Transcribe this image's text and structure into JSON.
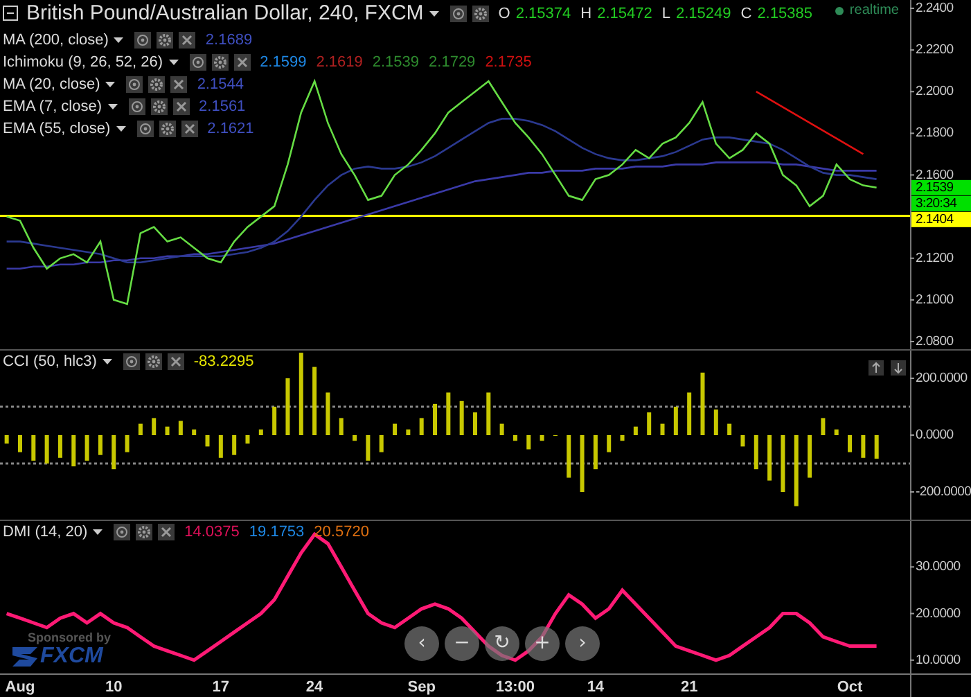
{
  "panels": [
    {
      "kind": "price",
      "legend": {
        "title": "British Pound/Australian Dollar, 240, FXCM",
        "ohlc": [
          {
            "label": "O",
            "value": "2.15374"
          },
          {
            "label": "H",
            "value": "2.15472"
          },
          {
            "label": "L",
            "value": "2.15249"
          },
          {
            "label": "C",
            "value": "2.15385"
          }
        ],
        "status": "realtime",
        "indicators": [
          {
            "name": "MA (200, close)",
            "values": [
              {
                "text": "2.1689",
                "color": "#3f4fc0"
              }
            ]
          },
          {
            "name": "Ichimoku (9, 26, 52, 26)",
            "values": [
              {
                "text": "2.1599",
                "color": "#1e88e5"
              },
              {
                "text": "2.1619",
                "color": "#b02020"
              },
              {
                "text": "2.1539",
                "color": "#2e8b2e"
              },
              {
                "text": "2.1729",
                "color": "#2e8b2e"
              },
              {
                "text": "2.1735",
                "color": "#d01010"
              }
            ]
          },
          {
            "name": "MA (20, close)",
            "values": [
              {
                "text": "2.1544",
                "color": "#3f4fc0"
              }
            ]
          },
          {
            "name": "EMA (7, close)",
            "values": [
              {
                "text": "2.1561",
                "color": "#3f4fc0"
              }
            ]
          },
          {
            "name": "EMA (55, close)",
            "values": [
              {
                "text": "2.1621",
                "color": "#3f4fc0"
              }
            ]
          }
        ]
      },
      "chart_data": {
        "type": "line",
        "ylim": [
          2.076,
          2.244
        ],
        "yticks": [
          {
            "value": 2.24,
            "label": "2.2400"
          },
          {
            "value": 2.22,
            "label": "2.2200"
          },
          {
            "value": 2.2,
            "label": "2.2000"
          },
          {
            "value": 2.18,
            "label": "2.1800"
          },
          {
            "value": 2.16,
            "label": "2.1600"
          },
          {
            "value": 2.12,
            "label": "2.1200"
          },
          {
            "value": 2.1,
            "label": "2.1000"
          },
          {
            "value": 2.08,
            "label": "2.0800"
          }
        ],
        "series": [
          {
            "color": "#e01010",
            "values": [
              null,
              null,
              null,
              null,
              null,
              null,
              null,
              null,
              null,
              null,
              null,
              null,
              null,
              null,
              null,
              null,
              null,
              null,
              null,
              null,
              null,
              null,
              null,
              null,
              null,
              null,
              null,
              null,
              null,
              null,
              null,
              null,
              null,
              null,
              null,
              null,
              null,
              null,
              null,
              null,
              null,
              null,
              null,
              null,
              null,
              null,
              null,
              null,
              null,
              null,
              null,
              null,
              null,
              null,
              null,
              null,
              2.2,
              null,
              null,
              null,
              null,
              null,
              null,
              null,
              2.17,
              null,
              null,
              null
            ]
          },
          {
            "color": "#3a3aa8",
            "values": [
              2.115,
              2.115,
              2.116,
              2.116,
              2.117,
              2.117,
              2.118,
              2.118,
              2.119,
              2.119,
              2.12,
              2.12,
              2.121,
              2.121,
              2.122,
              2.122,
              2.123,
              2.124,
              2.125,
              2.126,
              2.127,
              2.129,
              2.131,
              2.133,
              2.135,
              2.137,
              2.139,
              2.141,
              2.143,
              2.145,
              2.147,
              2.149,
              2.151,
              2.153,
              2.155,
              2.157,
              2.158,
              2.159,
              2.16,
              2.161,
              2.161,
              2.162,
              2.162,
              2.162,
              2.163,
              2.163,
              2.163,
              2.164,
              2.164,
              2.164,
              2.165,
              2.165,
              2.165,
              2.166,
              2.166,
              2.166,
              2.166,
              2.166,
              2.165,
              2.165,
              2.164,
              2.163,
              2.162,
              2.162,
              2.162,
              2.162,
              null,
              null
            ]
          },
          {
            "color": "#2b3990",
            "values": [
              2.128,
              2.128,
              2.127,
              2.126,
              2.125,
              2.124,
              2.123,
              2.122,
              2.12,
              2.118,
              2.118,
              2.119,
              2.12,
              2.121,
              2.121,
              2.121,
              2.121,
              2.122,
              2.123,
              2.125,
              2.128,
              2.133,
              2.14,
              2.148,
              2.155,
              2.16,
              2.163,
              2.164,
              2.163,
              2.163,
              2.164,
              2.166,
              2.169,
              2.173,
              2.177,
              2.181,
              2.185,
              2.187,
              2.187,
              2.186,
              2.184,
              2.181,
              2.177,
              2.173,
              2.17,
              2.168,
              2.167,
              2.167,
              2.168,
              2.169,
              2.171,
              2.174,
              2.177,
              2.178,
              2.178,
              2.177,
              2.176,
              2.175,
              2.172,
              2.168,
              2.164,
              2.161,
              2.16,
              2.16,
              2.159,
              2.158,
              null,
              null
            ]
          },
          {
            "color": "#66dd44",
            "values": [
              2.14,
              2.138,
              2.125,
              2.115,
              2.12,
              2.122,
              2.118,
              2.128,
              2.1,
              2.098,
              2.132,
              2.135,
              2.128,
              2.13,
              2.125,
              2.12,
              2.118,
              2.128,
              2.135,
              2.14,
              2.145,
              2.165,
              2.19,
              2.205,
              2.185,
              2.17,
              2.16,
              2.148,
              2.15,
              2.16,
              2.165,
              2.172,
              2.18,
              2.19,
              2.195,
              2.2,
              2.205,
              2.195,
              2.185,
              2.178,
              2.17,
              2.16,
              2.15,
              2.148,
              2.158,
              2.16,
              2.165,
              2.172,
              2.168,
              2.175,
              2.178,
              2.185,
              2.195,
              2.175,
              2.168,
              2.172,
              2.18,
              2.175,
              2.16,
              2.155,
              2.145,
              2.15,
              2.165,
              2.158,
              2.155,
              2.1539,
              null,
              null
            ]
          }
        ],
        "ref_lines": [
          {
            "axis": "y",
            "value": 2.1404
          }
        ],
        "annotations": [
          "2.1539",
          "3:20:34",
          "2.1404"
        ]
      }
    },
    {
      "kind": "cci",
      "legend": {
        "indicators": [
          {
            "name": "CCI (50, hlc3)",
            "values": [
              {
                "text": "-83.2295",
                "color": "#e6e600"
              }
            ]
          }
        ]
      },
      "chart_data": {
        "type": "bar",
        "ylim": [
          -300,
          300
        ],
        "yticks": [
          {
            "value": 200,
            "label": "200.0000"
          },
          {
            "value": 0,
            "label": "0.0000"
          },
          {
            "value": -200,
            "label": "-200.0000"
          }
        ],
        "series": [
          {
            "color": "#c8c800",
            "values": [
              -30,
              -60,
              -90,
              -100,
              -80,
              -110,
              -90,
              -70,
              -120,
              -60,
              40,
              60,
              30,
              50,
              20,
              -40,
              -80,
              -70,
              -30,
              20,
              100,
              200,
              290,
              240,
              150,
              60,
              -20,
              -90,
              -60,
              40,
              20,
              60,
              110,
              150,
              120,
              80,
              150,
              40,
              -20,
              -50,
              -20,
              0,
              -150,
              -200,
              -120,
              -60,
              -20,
              30,
              80,
              40,
              100,
              150,
              220,
              90,
              40,
              -40,
              -120,
              -160,
              -200,
              -250,
              -150,
              60,
              20,
              -60,
              -80,
              -83,
              null,
              null
            ]
          }
        ],
        "ref_lines": [
          {
            "axis": "y",
            "value": 100
          },
          {
            "axis": "y",
            "value": -100
          }
        ]
      }
    },
    {
      "kind": "dmi",
      "legend": {
        "indicators": [
          {
            "name": "DMI (14, 20)",
            "values": [
              {
                "text": "14.0375",
                "color": "#e0105a"
              },
              {
                "text": "19.1753",
                "color": "#1e88e5"
              },
              {
                "text": "20.5720",
                "color": "#e07010"
              }
            ]
          }
        ]
      },
      "chart_data": {
        "type": "line",
        "ylim": [
          7,
          40
        ],
        "categories": [
          null,
          "Aug",
          null,
          null,
          null,
          null,
          null,
          null,
          "10",
          null,
          null,
          null,
          null,
          null,
          null,
          null,
          "17",
          null,
          null,
          null,
          null,
          null,
          null,
          "24",
          null,
          null,
          null,
          null,
          null,
          null,
          null,
          "Sep",
          null,
          null,
          null,
          null,
          null,
          null,
          "13:00",
          null,
          null,
          null,
          null,
          null,
          "14",
          null,
          null,
          null,
          null,
          null,
          null,
          "21",
          null,
          null,
          null,
          null,
          null,
          null,
          null,
          null,
          null,
          null,
          null,
          "Oct",
          null,
          null,
          null,
          null
        ],
        "yticks": [
          {
            "value": 30,
            "label": "30.0000"
          },
          {
            "value": 20,
            "label": "20.0000"
          },
          {
            "value": 10,
            "label": "10.0000"
          }
        ],
        "series": [
          {
            "color": "#ff1a75",
            "values": [
              20,
              19,
              18,
              17,
              19,
              20,
              18,
              20,
              18,
              17,
              15,
              13,
              12,
              11,
              10,
              12,
              14,
              16,
              18,
              20,
              23,
              28,
              33,
              37,
              35,
              30,
              25,
              20,
              18,
              17,
              19,
              21,
              22,
              21,
              19,
              16,
              13,
              11,
              10,
              12,
              15,
              20,
              24,
              22,
              19,
              21,
              25,
              22,
              19,
              16,
              13,
              12,
              11,
              10,
              11,
              13,
              15,
              17,
              20,
              20,
              18,
              15,
              14,
              13,
              13,
              13,
              null,
              null
            ]
          }
        ]
      }
    }
  ],
  "nav_buttons": [
    {
      "label": "‹"
    },
    {
      "label": "−"
    },
    {
      "label": "↻"
    },
    {
      "label": "+"
    },
    {
      "label": "›"
    }
  ],
  "sponsor": {
    "caption": "Sponsored by",
    "logo": "FXCM"
  }
}
